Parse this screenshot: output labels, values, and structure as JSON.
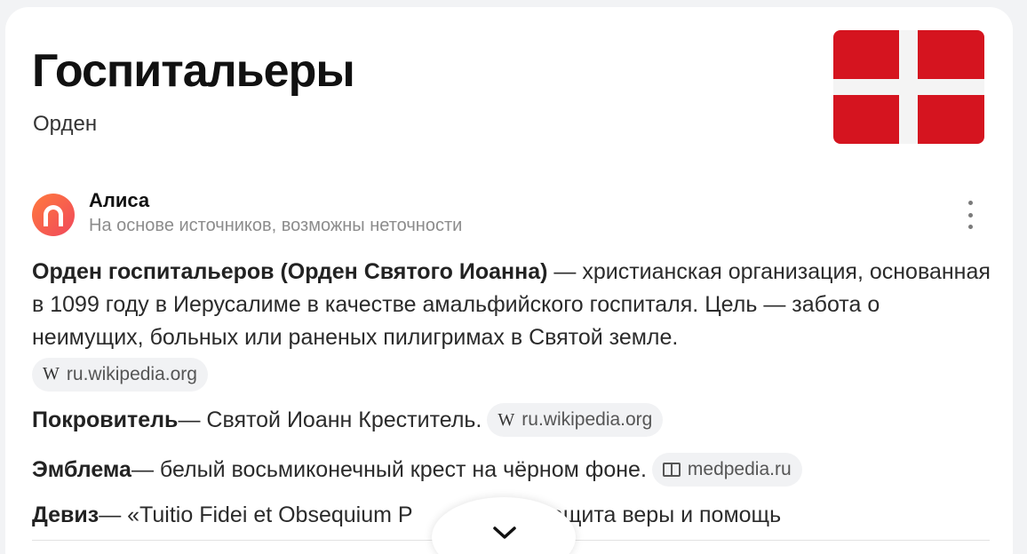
{
  "header": {
    "title": "Госпитальеры",
    "subtitle": "Орден",
    "flag": {
      "name": "Флаг ордена",
      "colors": {
        "field": "#d5141f",
        "cross": "#f4f4f4"
      }
    }
  },
  "alice": {
    "name": "Алиса",
    "note": "На основе источников, возможны неточности",
    "logo_colors": [
      "#ff7a3d",
      "#f0485c"
    ]
  },
  "answer": {
    "intro_bold": "Орден госпитальеров (Орден Святого Иоанна)",
    "intro_text": " — христианская организация, основанная в 1099 году в Иерусалиме в качестве амальфийского госпиталя. Цель — забота о неимущих, больных или раненых пилигримах в Святой земле.",
    "intro_source": {
      "icon": "wikipedia-icon",
      "label": "ru.wikipedia.org"
    },
    "facts": [
      {
        "term": "Покровитель",
        "text": " — Святой Иоанн Креститель.",
        "source": {
          "icon": "wikipedia-icon",
          "label": "ru.wikipedia.org"
        }
      },
      {
        "term": "Эмблема",
        "text": " — белый восьмиконечный крест на чёрном фоне.",
        "source": {
          "icon": "book-icon",
          "label": "medpedia.ru"
        }
      },
      {
        "term": "Девиз",
        "text_before": " — «Tuitio Fidei et Obsequium P",
        "text_after": "(«Защита веры и помощь"
      }
    ]
  },
  "ui": {
    "expand_icon": "chevron-down-icon",
    "more_icon": "more-vertical-icon"
  }
}
